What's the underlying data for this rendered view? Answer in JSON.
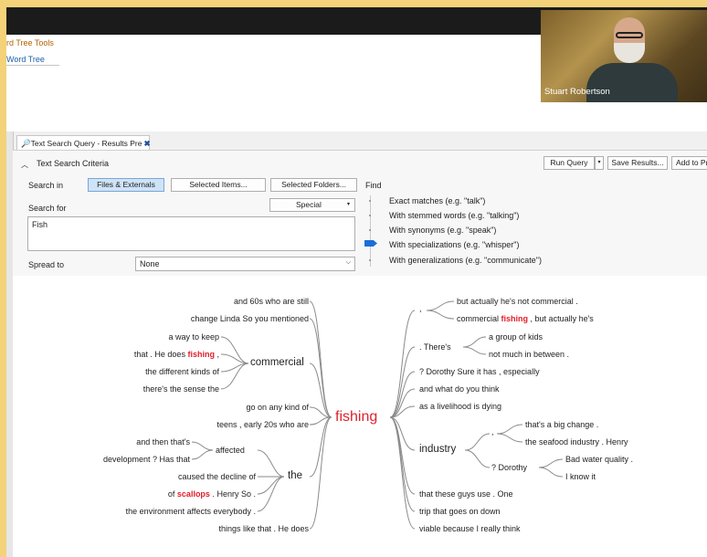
{
  "ribbon": {
    "tools_tab": "rd Tree Tools",
    "word_tree_tab": "Word Tree"
  },
  "webcam": {
    "name": "Stuart Robertson"
  },
  "doc_tab": {
    "title": "Text Search Query - Results Pre",
    "close": "✖"
  },
  "query": {
    "section_title": "Text Search Criteria",
    "search_in_label": "Search in",
    "search_in_buttons": [
      "Files & Externals",
      "Selected Items...",
      "Selected Folders..."
    ],
    "search_for_label": "Search for",
    "search_for_value": "Fish",
    "special_label": "Special",
    "spread_label": "Spread to",
    "spread_value": "None",
    "find_label": "Find",
    "find_options": [
      "Exact matches (e.g. \"talk\")",
      "With stemmed words (e.g. \"talking\")",
      "With synonyms (e.g. \"speak\")",
      "With specializations (e.g. \"whisper\")",
      "With generalizations (e.g. \"communicate\")"
    ],
    "find_selected": "With specializations (e.g. \"whisper\")",
    "run_query": "Run Query",
    "save_results": "Save Results...",
    "add_to": "Add to Pr"
  },
  "word_tree": {
    "root": "fishing",
    "left": {
      "l1": "and 60s who are still",
      "l2": "change Linda So you mentioned",
      "l3": "a way to keep",
      "l4a": "that . He does",
      "l4b": "fishing",
      "l4c": ",",
      "l5": "the different kinds of",
      "l6": "there's the sense the",
      "commercial": "commercial",
      "l7": "go on any kind of",
      "l8": "teens , early 20s who are",
      "l9": "and then that's",
      "l10": "development ? Has that",
      "affected": "affected",
      "l11": "caused the decline of",
      "l12a": "of",
      "l12b": "scallops",
      "l12c": ". Henry So .",
      "the": "the",
      "l13": "the environment affects everybody .",
      "l14": "things like that . He does"
    },
    "right": {
      "comma1": ",",
      "r1": "but actually he's not commercial .",
      "r2a": "commercial",
      "r2b": "fishing",
      "r2c": ", but actually he's",
      "theres": ". There's",
      "r3": "a group of kids",
      "r4": "not much in between .",
      "r5": "? Dorothy Sure it has , especially",
      "r6": "and what do you think",
      "r7": "as a livelihood is dying",
      "industry": "industry",
      "comma2": ",",
      "r8": "that's a big change .",
      "r9": "the seafood industry . Henry",
      "dorothy": "? Dorothy",
      "r10": "Bad water quality .",
      "r11": "I know it",
      "r12": "that these guys use . One",
      "r13": "trip that goes on down",
      "r14": "viable because I really think"
    }
  }
}
